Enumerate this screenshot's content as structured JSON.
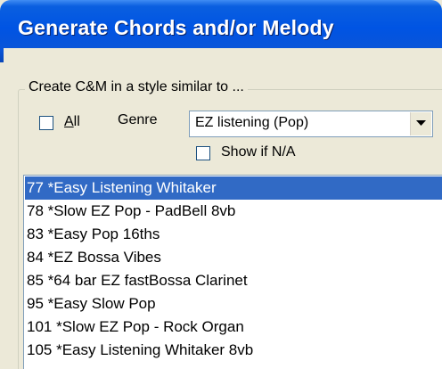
{
  "window": {
    "title": "Generate Chords and/or Melody"
  },
  "group": {
    "label": "Create C&M in a style similar to ..."
  },
  "all_checkbox": {
    "label": "All",
    "checked": false
  },
  "genre": {
    "label": "Genre",
    "selected": "EZ listening (Pop)"
  },
  "show_na_checkbox": {
    "label": "Show if N/A",
    "checked": false
  },
  "styles_list": {
    "selected_index": 0,
    "items": [
      "77 *Easy Listening Whitaker",
      "78 *Slow EZ Pop  - PadBell 8vb",
      "83 *Easy Pop 16ths",
      "84 *EZ Bossa Vibes",
      "85 *64 bar EZ fastBossa Clarinet",
      "95 *Easy Slow Pop",
      "101 *Slow EZ Pop  - Rock Organ",
      "105 *Easy Listening Whitaker 8vb"
    ]
  },
  "colors": {
    "titlebar": "#0054e3",
    "selection": "#316ac5",
    "dialog_bg": "#ece9d8"
  }
}
